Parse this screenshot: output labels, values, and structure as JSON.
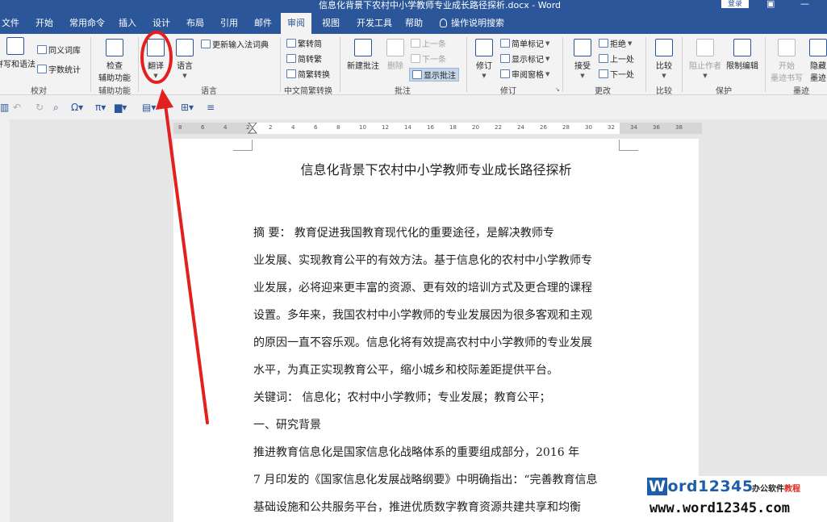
{
  "titlebar": {
    "title": "信息化背景下农村中小学教师专业成长路径探析.docx  -  Word",
    "login": "登录"
  },
  "tabs": [
    "文件",
    "开始",
    "常用命令",
    "插入",
    "设计",
    "布局",
    "引用",
    "邮件",
    "审阅",
    "视图",
    "开发工具",
    "帮助",
    "操作说明搜索"
  ],
  "active_tab": "审阅",
  "ribbon": {
    "proofing": {
      "spell": "拼写和语法",
      "thesaurus": "同义词库",
      "wordcount": "字数统计",
      "label": "校对"
    },
    "accessibility": {
      "check": "检查",
      "check2": "辅助功能",
      "label": "辅助功能"
    },
    "language": {
      "translate": "翻译",
      "language": "语言",
      "update_ime": "更新输入法词典",
      "label": "语言"
    },
    "chinese": {
      "t2s": "繁转简",
      "s2t": "简转繁",
      "convert": "简繁转换",
      "label": "中文简繁转换"
    },
    "comments": {
      "new": "新建批注",
      "delete": "删除",
      "prev": "上一条",
      "next": "下一条",
      "show": "显示批注",
      "label": "批注"
    },
    "tracking": {
      "track": "修订",
      "simple_markup": "简单标记",
      "show_markup": "显示标记",
      "review_pane": "审阅窗格",
      "label": "修订"
    },
    "changes": {
      "accept": "接受",
      "reject": "拒绝",
      "prev": "上一处",
      "next": "下一处",
      "label": "更改"
    },
    "compare": {
      "compare": "比较",
      "label": "比较"
    },
    "protect": {
      "block_authors": "阻止作者",
      "restrict": "限制编辑",
      "label": "保护"
    },
    "ink": {
      "start": "开始",
      "start2": "墨迹书写",
      "hide": "隐藏",
      "hide2": "墨迹",
      "label": "墨迹"
    }
  },
  "ruler_numbers": [
    "8",
    "6",
    "4",
    "2",
    "2",
    "4",
    "6",
    "8",
    "10",
    "12",
    "14",
    "16",
    "18",
    "20",
    "22",
    "24",
    "26",
    "28",
    "30",
    "32",
    "34",
    "36",
    "38"
  ],
  "document": {
    "title": "信息化背景下农村中小学教师专业成长路径探析",
    "lines": [
      "    摘    要：   教育促进我国教育现代化的重要途径，是解决教师专",
      "业发展、实现教育公平的有效方法。基于信息化的农村中小学教师专",
      "业发展，必将迎来更丰富的资源、更有效的培训方式及更合理的课程",
      "设置。多年来，我国农村中小学教师的专业发展因为很多客观和主观",
      "的原因一直不容乐观。信息化将有效提高农村中小学教师的专业发展",
      "水平，为真正实现教育公平，缩小城乡和校际差距提供平台。",
      "    关键词：   信息化；农村中小学教师；专业发展；教育公平；",
      "一、研究背景",
      "    推进教育信息化是国家信息化战略体系的重要组成部分，2016 年",
      "7 月印发的《国家信息化发展战略纲要》中明确指出：“完善教育信息",
      "基础设施和公共服务平台，推进优质数字教育资源共建共享和均衡"
    ]
  },
  "watermark": {
    "brand_w": "W",
    "brand_rest": "ord12345",
    "tag_a": "办公软件",
    "tag_b": "教程",
    "url": "www.word12345.com"
  }
}
